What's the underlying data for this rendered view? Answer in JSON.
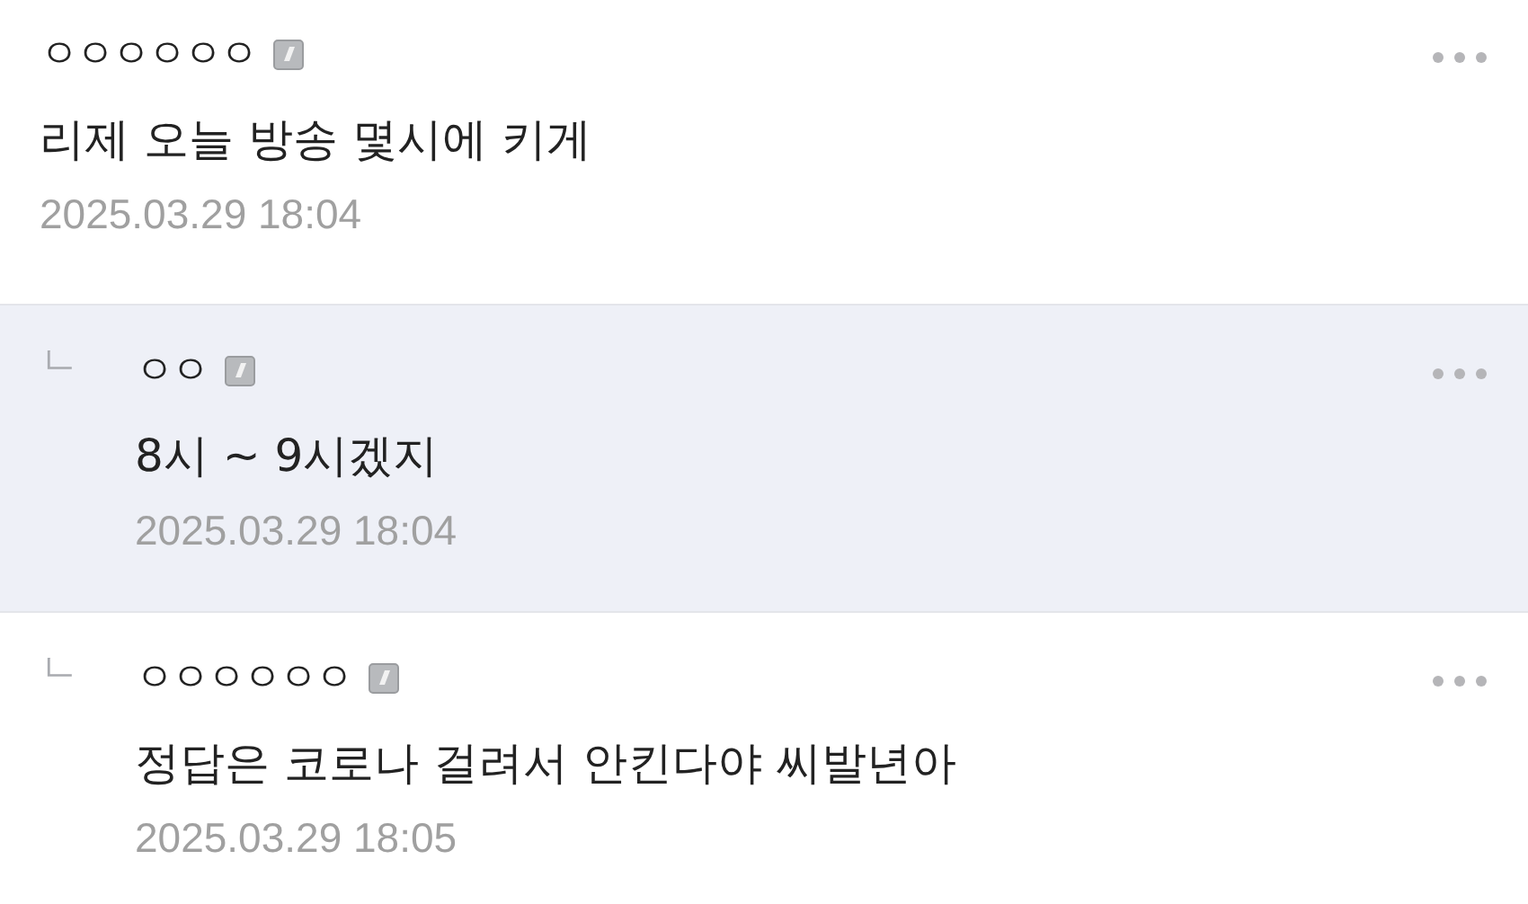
{
  "comments": [
    {
      "kind": "comment",
      "highlighted": false,
      "author": "ㅇㅇㅇㅇㅇㅇ",
      "text": "리제 오늘 방송 몇시에 키게",
      "date": "2025.03.29 18:04"
    },
    {
      "kind": "reply",
      "highlighted": true,
      "author": "ㅇㅇ",
      "text": "8시 ~ 9시겠지",
      "date": "2025.03.29 18:04",
      "reply_mark": "ㄴ"
    },
    {
      "kind": "reply",
      "highlighted": false,
      "author": "ㅇㅇㅇㅇㅇㅇ",
      "text": "정답은 코로나 걸려서 안킨다야 씨발년아",
      "date": "2025.03.29 18:05",
      "reply_mark": "ㄴ"
    }
  ]
}
